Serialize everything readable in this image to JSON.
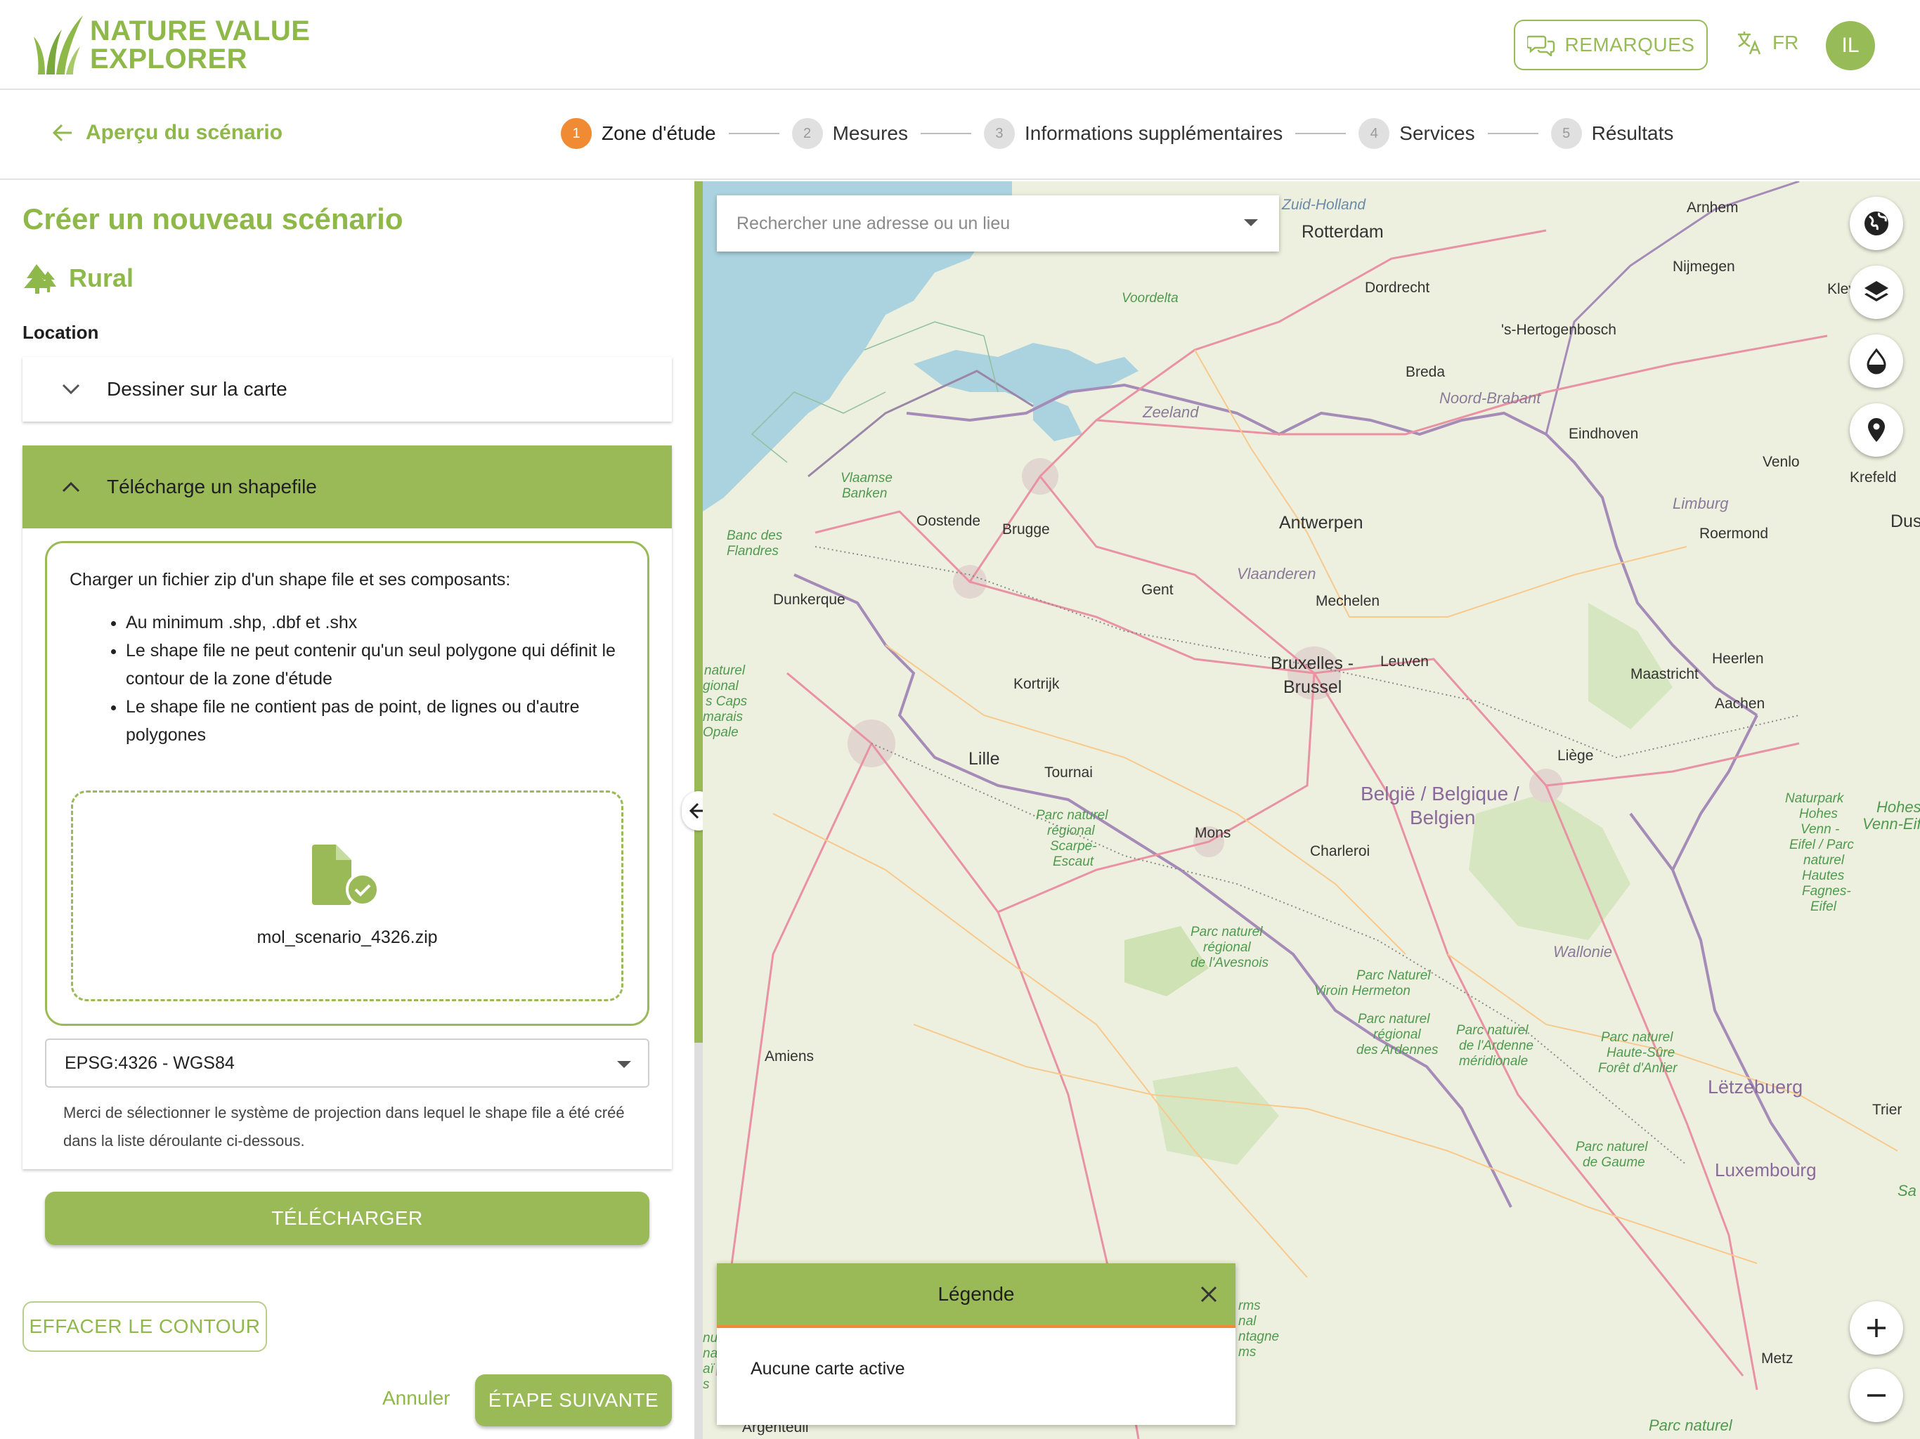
{
  "header": {
    "logo_line1": "NATURE VALUE",
    "logo_line2": "EXPLORER",
    "remarks_label": "REMARQUES",
    "language": "FR",
    "avatar_initials": "IL"
  },
  "nav": {
    "back_label": "Aperçu du scénario",
    "steps": [
      {
        "num": "1",
        "label": "Zone d'étude",
        "active": true
      },
      {
        "num": "2",
        "label": "Mesures",
        "active": false
      },
      {
        "num": "3",
        "label": "Informations supplémentaires",
        "active": false
      },
      {
        "num": "4",
        "label": "Services",
        "active": false
      },
      {
        "num": "5",
        "label": "Résultats",
        "active": false
      }
    ]
  },
  "panel": {
    "title": "Créer un nouveau scénario",
    "category": "Rural",
    "location_label": "Location",
    "accordion_draw": "Dessiner sur la carte",
    "accordion_upload": "Télécharge un shapefile",
    "upload_intro": "Charger un fichier zip d'un shape file et ses composants:",
    "requirements": [
      "Au minimum .shp, .dbf et .shx",
      "Le shape file ne peut contenir qu'un seul polygone qui définit le contour de la zone d'étude",
      "Le shape file ne contient pas de point, de lignes ou d'autre polygones"
    ],
    "file_name": "mol_scenario_4326.zip",
    "projection_value": "EPSG:4326 - WGS84",
    "projection_helper": "Merci de sélectionner le système de projection dans lequel le shape file a été créé dans la liste déroulante ci-dessous.",
    "upload_button": "TÉLÉCHARGER",
    "clear_button": "EFFACER LE CONTOUR",
    "cancel_link": "Annuler",
    "next_button": "ÉTAPE SUIVANTE"
  },
  "map": {
    "search_placeholder": "Rechercher une adresse ou un lieu",
    "legend_title": "Légende",
    "legend_empty": "Aucune carte active",
    "controls": [
      "globe-icon",
      "layers-icon",
      "drop-icon",
      "map-pin-icon",
      "zoom-in-icon",
      "zoom-out-icon"
    ],
    "places": {
      "zuid_holland": "Zuid-Holland",
      "rotterdam": "Rotterdam",
      "arnhem": "Arnhem",
      "nijmegen": "Nijmegen",
      "kleve": "Kleve",
      "dordrecht": "Dordrecht",
      "hertogenbosch": "'s-Hertogenbosch",
      "voordelta": "Voordelta",
      "breda": "Breda",
      "noord_brabant": "Noord-Brabant",
      "eindhoven": "Eindhoven",
      "venlo": "Venlo",
      "krefeld": "Krefeld",
      "zeeland": "Zeeland",
      "vlaamse_banken_1": "Vlaamse",
      "vlaamse_banken_2": "Banken",
      "oostende": "Oostende",
      "brugge": "Brugge",
      "limburg": "Limburg",
      "roermond": "Roermond",
      "antwerpen": "Antwerpen",
      "dus": "Dus",
      "banc_1": "Banc des",
      "banc_2": "Flandres",
      "vlaanderen": "Vlaanderen",
      "gent": "Gent",
      "dunkerque": "Dunkerque",
      "mechelen": "Mechelen",
      "bruxelles": "Bruxelles -",
      "brussel": "Brussel",
      "leuven": "Leuven",
      "heerlen": "Heerlen",
      "maastricht": "Maastricht",
      "aachen": "Aachen",
      "kortrijk": "Kortrijk",
      "lille": "Lille",
      "tournai": "Tournai",
      "liege": "Liège",
      "belgique_1": "België / Belgique /",
      "belgique_2": "Belgien",
      "pnr_scarpe_1": "Parc naturel",
      "pnr_scarpe_2": "régional",
      "pnr_scarpe_3": "Scarpe-",
      "pnr_scarpe_4": "Escaut",
      "mons": "Mons",
      "charleroi": "Charleroi",
      "naturpark_1": "Naturpark",
      "naturpark_2": "Hohes",
      "naturpark_3": "Venn -",
      "naturpark_4": "Eifel / Parc",
      "naturpark_5": "naturel",
      "naturpark_6": "Hautes",
      "naturpark_7": "Fagnes-",
      "naturpark_8": "Eifel",
      "hohes_1": "Hohes",
      "hohes_2": "Venn-Eif",
      "avesnois_1": "Parc naturel",
      "avesnois_2": "régional",
      "avesnois_3": "de l'Avesnois",
      "wallonie": "Wallonie",
      "viroin_1": "Parc Naturel",
      "viroin_2": "Viroin Hermeton",
      "ardennes_1": "Parc naturel",
      "ardennes_2": "régional",
      "ardennes_3": "des Ardennes",
      "ardenne_m_1": "Parc naturel",
      "ardenne_m_2": "de l'Ardenne",
      "ardenne_m_3": "méridionale",
      "sure_1": "Parc naturel",
      "sure_2": "Haute-Sûre",
      "sure_3": "Forêt d'Anlier",
      "amiens": "Amiens",
      "letzebuerg": "Lëtzebuerg",
      "trier": "Trier",
      "gaume_1": "Parc naturel",
      "gaume_2": "de Gaume",
      "luxembourg": "Luxembourg",
      "sa": "Sa",
      "metz": "Metz",
      "argenteuil": "Argenteuil",
      "parc_naturel_bottom": "Parc naturel",
      "opale_1": "naturel",
      "opale_2": "gional",
      "opale_3": "s Caps",
      "opale_4": "marais",
      "opale_5": "Opale",
      "rms_1": "rms",
      "rms_2": "nal",
      "rms_3": "ntagne",
      "rms_4": "ms",
      "nu_1": "nu",
      "nu_2": "nal",
      "nu_3": "aï",
      "nu_4": "s"
    }
  },
  "colors": {
    "brand_green": "#9aba58",
    "step_active": "#f08a33",
    "sea": "#aad3df",
    "land": "#eef0df"
  }
}
